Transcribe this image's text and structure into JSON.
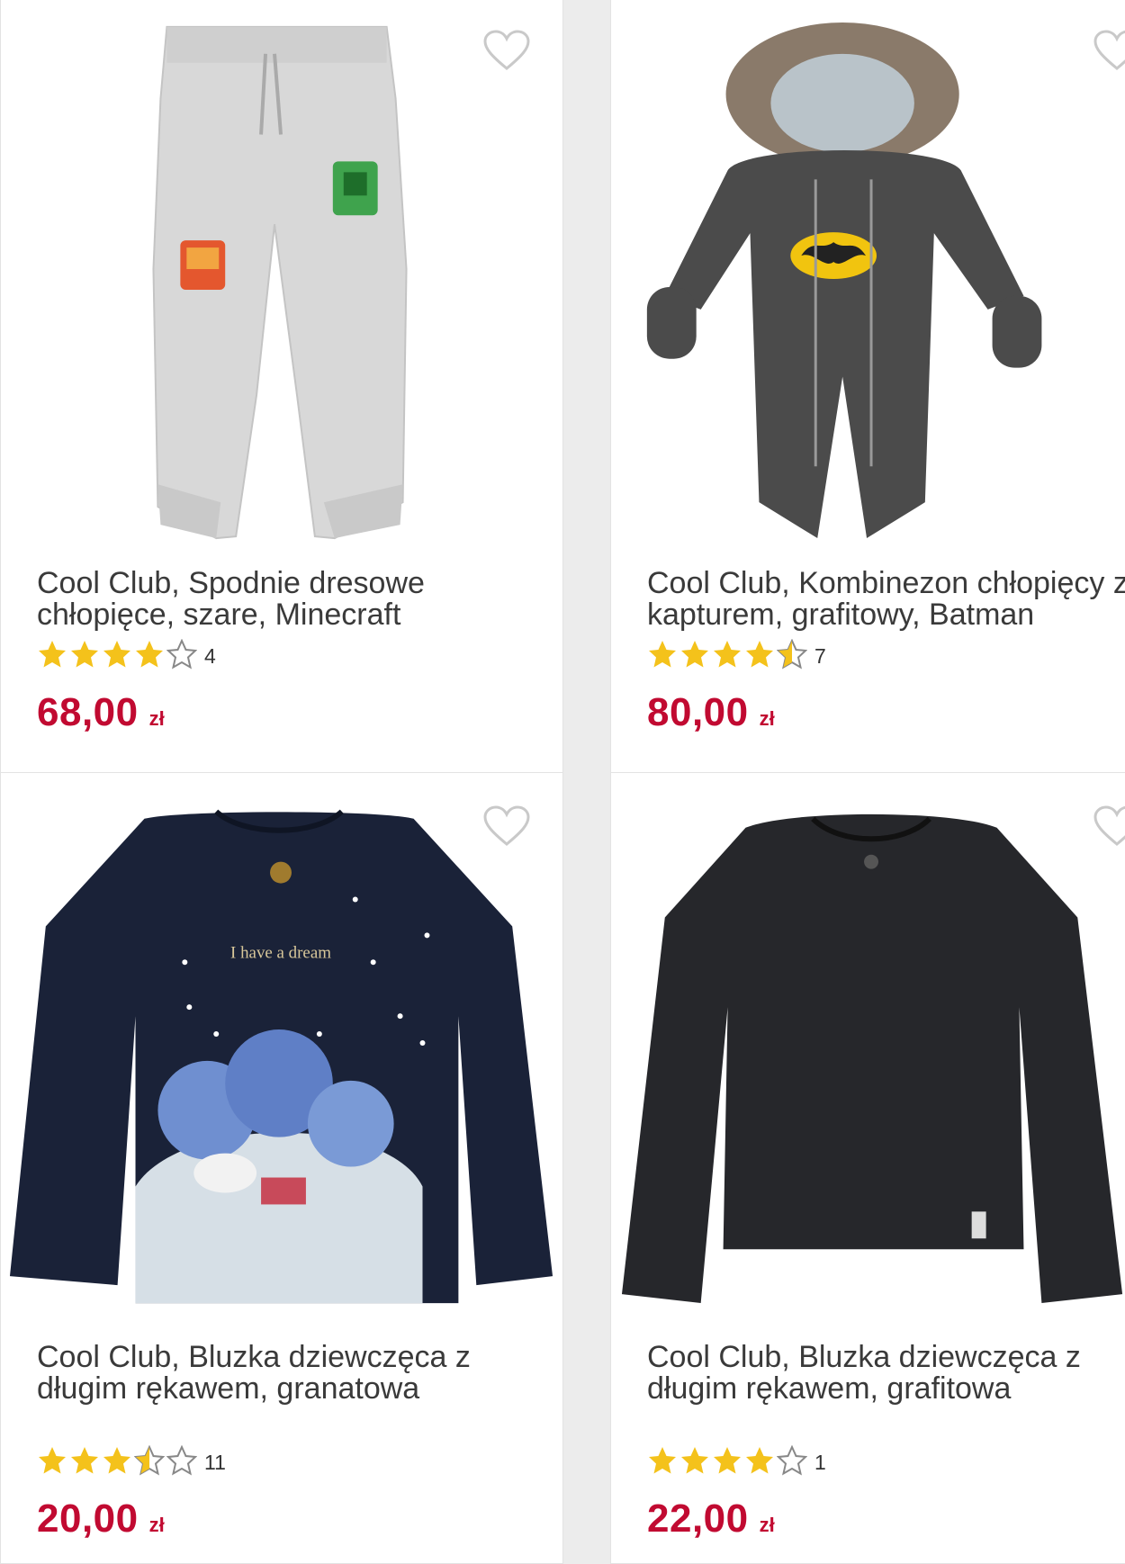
{
  "colors": {
    "price": "#c10a31",
    "star": "#f4c21b",
    "star_empty": "#888888"
  },
  "products": [
    {
      "title": "Cool Club, Spodnie dresowe\nchłopięce, szare, Minecraft",
      "rating": 4,
      "rating_count": "4",
      "price": "68,00",
      "currency": "zł",
      "image_icon": "grey-jogger-pants-image"
    },
    {
      "title": "Cool Club, Kombinezon chłopięcy z\nkapturem, grafitowy, Batman",
      "rating": 4.5,
      "rating_count": "7",
      "price": "80,00",
      "currency": "zł",
      "image_icon": "batman-snowsuit-image"
    },
    {
      "title": "Cool Club, Bluzka dziewczęca z\ndługim rękawem, granatowa",
      "rating": 3.5,
      "rating_count": "11",
      "price": "20,00",
      "currency": "zł",
      "image_icon": "navy-winter-blouse-image",
      "image_text": "I have a dream"
    },
    {
      "title": "Cool Club, Bluzka dziewczęca z\ndługim rękawem, grafitowa",
      "rating": 4,
      "rating_count": "1",
      "price": "22,00",
      "currency": "zł",
      "image_icon": "black-longsleeve-image"
    }
  ]
}
